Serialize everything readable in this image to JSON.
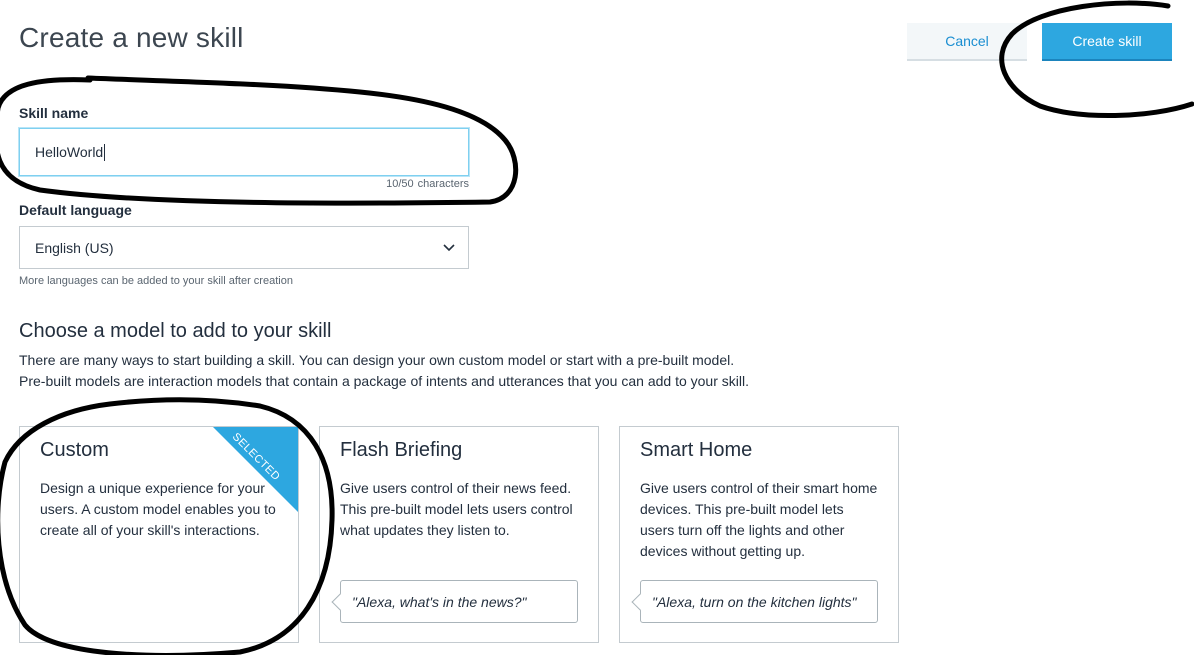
{
  "page": {
    "title": "Create a new skill"
  },
  "actions": {
    "cancel_label": "Cancel",
    "create_label": "Create skill"
  },
  "skill_name": {
    "label": "Skill name",
    "value": "HelloWorld",
    "count": "10/50",
    "count_unit": "characters"
  },
  "language": {
    "label": "Default language",
    "selected": "English (US)",
    "hint": "More languages can be added to your skill after creation"
  },
  "models": {
    "title": "Choose a model to add to your skill",
    "description_1": "There are many ways to start building a skill. You can design your own custom model or start with a pre-built model.",
    "description_2": "Pre-built models are interaction models that contain a package of intents and utterances that you can add to your skill.",
    "cards": [
      {
        "title": "Custom",
        "description": "Design a unique experience for your users. A custom model enables you to create all of your skill's interactions.",
        "badge": "SELECTED",
        "selected": true
      },
      {
        "title": "Flash Briefing",
        "description": "Give users control of their news feed. This pre-built model lets users control what updates they listen to.",
        "example": "\"Alexa, what's in the news?\""
      },
      {
        "title": "Smart Home",
        "description": "Give users control of their smart home devices. This pre-built model lets users turn off the lights and other devices without getting up.",
        "example": "\"Alexa, turn on the kitchen lights\""
      }
    ]
  },
  "colors": {
    "accent": "#2da7e0",
    "link": "#1a8ed1",
    "annotation_ink": "#000000"
  },
  "icons": {
    "select_arrow": "chevron-down-icon"
  }
}
